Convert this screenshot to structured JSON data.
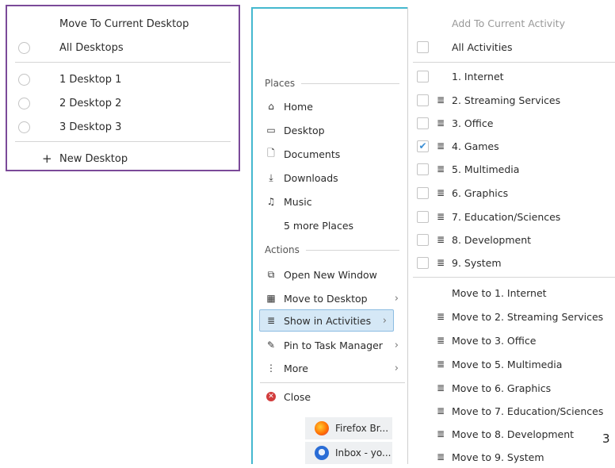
{
  "desktop_menu": {
    "title": "Move To Current Desktop",
    "all": "All Desktops",
    "desktops": [
      "1 Desktop 1",
      "2 Desktop 2",
      "3 Desktop 3"
    ],
    "new_desktop": "New Desktop"
  },
  "context_menu": {
    "places_header": "Places",
    "places": [
      "Home",
      "Desktop",
      "Documents",
      "Downloads",
      "Music"
    ],
    "more_places": "5 more Places",
    "actions_header": "Actions",
    "actions": [
      "Open New Window",
      "Move to Desktop",
      "Show in Activities",
      "Pin to Task Manager",
      "More"
    ],
    "close": "Close"
  },
  "activities_menu": {
    "title": "Add To Current Activity",
    "all": "All Activities",
    "activities": [
      {
        "label": "1. Internet",
        "checked": false
      },
      {
        "label": "2. Streaming Services",
        "checked": false
      },
      {
        "label": "3. Office",
        "checked": false
      },
      {
        "label": "4. Games",
        "checked": true
      },
      {
        "label": "5. Multimedia",
        "checked": false
      },
      {
        "label": "6. Graphics",
        "checked": false
      },
      {
        "label": "7. Education/Sciences",
        "checked": false
      },
      {
        "label": "8. Development",
        "checked": false
      },
      {
        "label": "9. System",
        "checked": false
      }
    ],
    "move_first": "Move to 1. Internet",
    "moves": [
      "Move to 2. Streaming Services",
      "Move to 3. Office",
      "Move to 5. Multimedia",
      "Move to 6. Graphics",
      "Move to 7. Education/Sciences",
      "Move to 8. Development",
      "Move to 9. System"
    ]
  },
  "taskbar": {
    "items": [
      "Firefox Br...",
      "Inbox - yo..."
    ]
  },
  "corner_number": "3",
  "colors": {
    "desktop_border": "#7b4a99",
    "window_border": "#45b8cf",
    "highlight": "#d5e8f6",
    "check": "#3b8ed4",
    "close": "#d23c3c"
  }
}
